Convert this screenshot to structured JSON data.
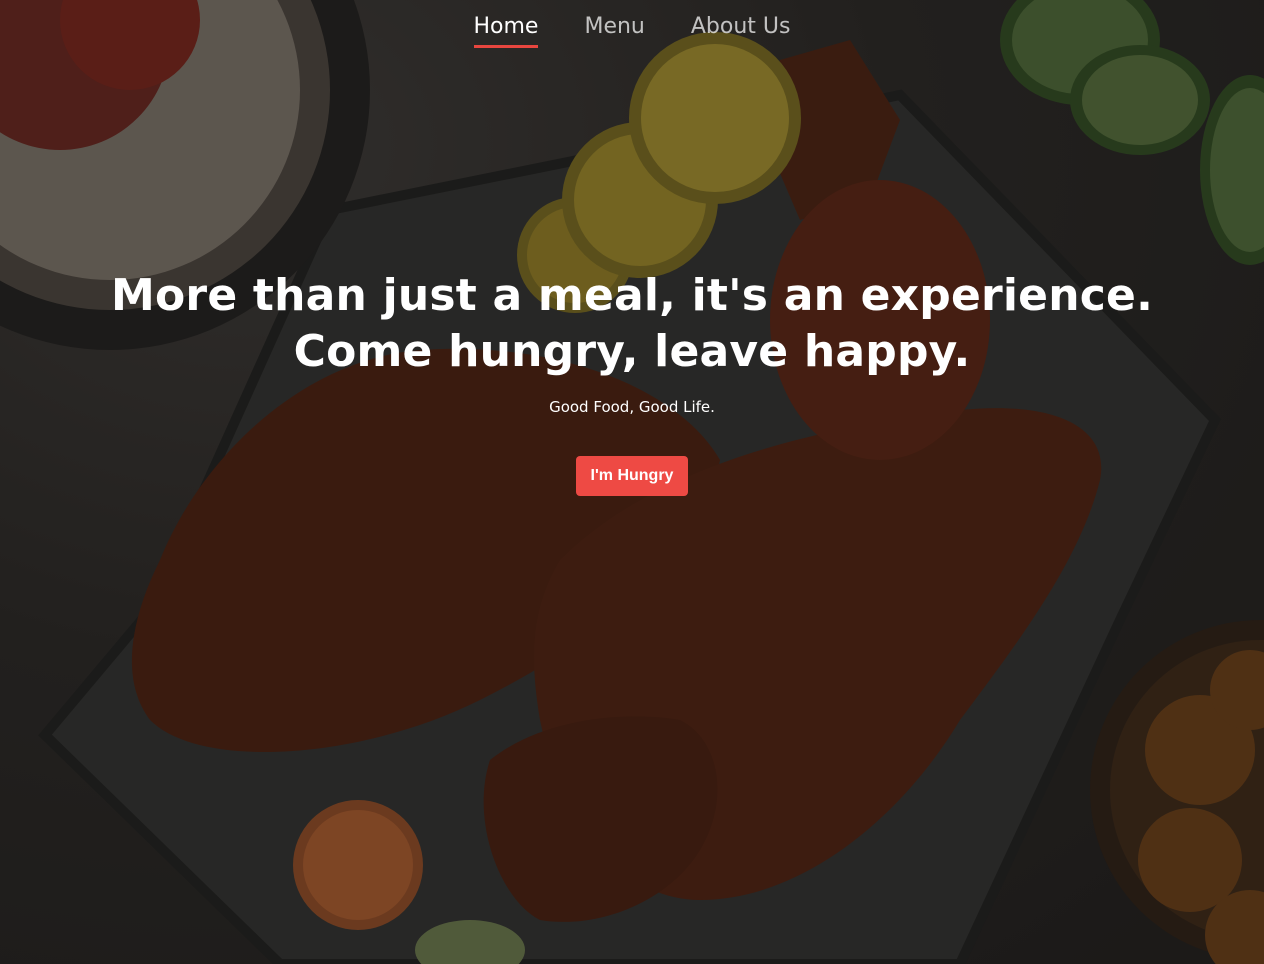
{
  "nav": {
    "items": [
      {
        "label": "Home",
        "active": true
      },
      {
        "label": "Menu",
        "active": false
      },
      {
        "label": "About Us",
        "active": false
      }
    ]
  },
  "hero": {
    "headline_line1": "More than just a meal, it's an experience.",
    "headline_line2": "Come hungry, leave happy.",
    "subtitle": "Good Food, Good Life.",
    "cta_label": "I'm Hungry"
  },
  "colors": {
    "accent": "#ee4a44",
    "text": "#ffffff",
    "background": "#2f2c2a"
  }
}
